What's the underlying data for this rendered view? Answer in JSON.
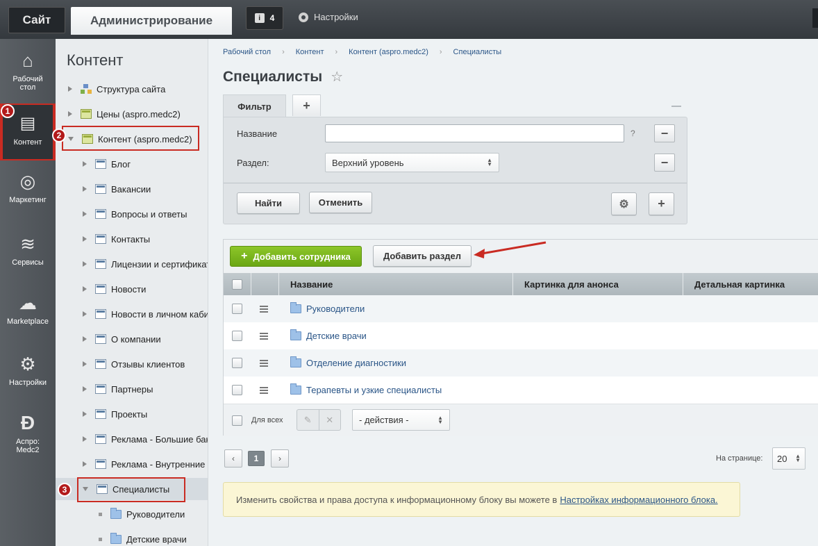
{
  "topbar": {
    "site_tab": "Сайт",
    "admin_tab": "Администрирование",
    "notifications_count": "4",
    "settings_label": "Настройки"
  },
  "leftnav": [
    {
      "label": "Рабочий стол",
      "icon": "home-icon"
    },
    {
      "label": "Контент",
      "icon": "document-icon",
      "active": true
    },
    {
      "label": "Маркетинг",
      "icon": "target-icon"
    },
    {
      "label": "Сервисы",
      "icon": "layers-icon"
    },
    {
      "label": "Marketplace",
      "icon": "cloud-download-icon"
    },
    {
      "label": "Настройки",
      "icon": "gear-icon"
    },
    {
      "label": "Аспро: Medc2",
      "icon": "aspro-logo-icon"
    }
  ],
  "badges": [
    "1",
    "2",
    "3"
  ],
  "tree": {
    "title": "Контент",
    "items": [
      {
        "label": "Структура сайта",
        "level": 0
      },
      {
        "label": "Цены (aspro.medc2)",
        "level": 0
      },
      {
        "label": "Контент (aspro.medc2)",
        "level": 0,
        "expanded": true
      },
      {
        "label": "Блог",
        "level": 1
      },
      {
        "label": "Вакансии",
        "level": 1
      },
      {
        "label": "Вопросы и ответы",
        "level": 1
      },
      {
        "label": "Контакты",
        "level": 1
      },
      {
        "label": "Лицензии и сертификаты",
        "level": 1
      },
      {
        "label": "Новости",
        "level": 1
      },
      {
        "label": "Новости в личном кабинете",
        "level": 1
      },
      {
        "label": "О компании",
        "level": 1
      },
      {
        "label": "Отзывы клиентов",
        "level": 1
      },
      {
        "label": "Партнеры",
        "level": 1
      },
      {
        "label": "Проекты",
        "level": 1
      },
      {
        "label": "Реклама - Большие баннеры",
        "level": 1
      },
      {
        "label": "Реклама - Внутренние",
        "level": 1
      },
      {
        "label": "Специалисты",
        "level": 1,
        "expanded": true,
        "selected": true
      },
      {
        "label": "Руководители",
        "level": 2
      },
      {
        "label": "Детские врачи",
        "level": 2
      }
    ]
  },
  "breadcrumb": [
    "Рабочий стол",
    "Контент",
    "Контент (aspro.medc2)",
    "Специалисты"
  ],
  "page_title": "Специалисты",
  "filter": {
    "tab_label": "Фильтр",
    "add_tab": "+",
    "name_label": "Название",
    "name_value": "",
    "help": "?",
    "section_label": "Раздел:",
    "section_value": "Верхний уровень",
    "find_button": "Найти",
    "cancel_button": "Отменить"
  },
  "grid": {
    "add_employee_button": "Добавить сотрудника",
    "add_section_button": "Добавить раздел",
    "columns": [
      "Название",
      "Картинка для анонса",
      "Детальная картинка"
    ],
    "rows": [
      "Руководители",
      "Детские врачи",
      "Отделение диагностики",
      "Терапевты и узкие специалисты"
    ],
    "for_all_label": "Для всех",
    "actions_select": "- действия -"
  },
  "pagination": {
    "current_page": "1",
    "per_page_label": "На странице:",
    "per_page_value": "20"
  },
  "note": {
    "text": "Изменить свойства и права доступа к информационному блоку вы можете в",
    "link": "Настройках информационного блока."
  },
  "colors": {
    "accent_red": "#c92b22",
    "green_button": "#6aa614",
    "link": "#2a5587"
  }
}
